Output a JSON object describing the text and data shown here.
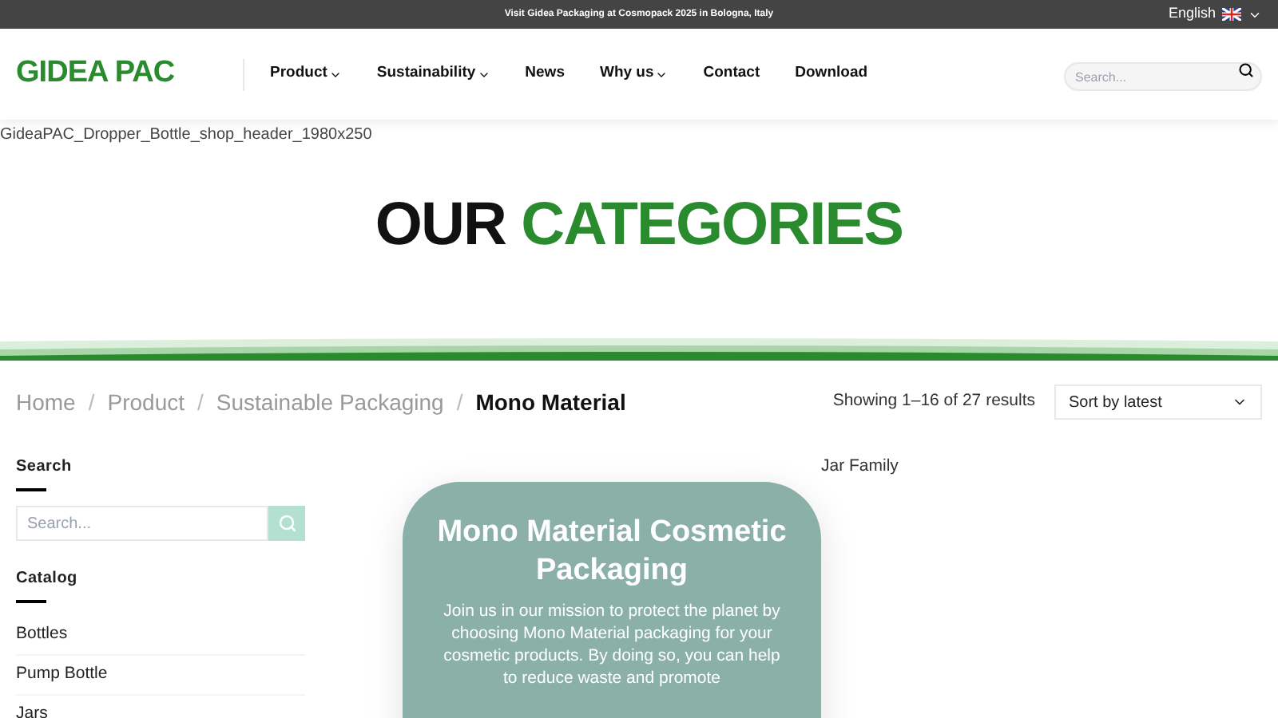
{
  "announcement": "Visit Gidea Packaging at Cosmopack 2025 in Bologna, Italy",
  "language": {
    "label": "English"
  },
  "logo": "GIDEA PAC",
  "nav": [
    {
      "label": "Product",
      "has_menu": true
    },
    {
      "label": "Sustainability",
      "has_menu": true
    },
    {
      "label": "News",
      "has_menu": false
    },
    {
      "label": "Why us",
      "has_menu": true
    },
    {
      "label": "Contact",
      "has_menu": false
    },
    {
      "label": "Download",
      "has_menu": false
    }
  ],
  "header_search": {
    "placeholder": "Search..."
  },
  "banner_alt": "GideaPAC_Dropper_Bottle_shop_header_1980x250",
  "heading": {
    "first": "OUR",
    "second": "CATEGORIES"
  },
  "breadcrumb": [
    {
      "label": "Home",
      "current": false
    },
    {
      "separator": "/"
    },
    {
      "label": "Product",
      "current": false
    },
    {
      "separator": "/"
    },
    {
      "label": "Sustainable Packaging",
      "current": false
    },
    {
      "separator": "/"
    },
    {
      "label": "Mono Material",
      "current": true
    }
  ],
  "result_count": "Showing 1–16 of 27 results",
  "sort": {
    "value": "Sort by latest"
  },
  "sidebar": {
    "search_title": "Search",
    "search_placeholder": "Search...",
    "catalog_title": "Catalog",
    "items": [
      "Bottles",
      "Pump Bottle",
      "Jars"
    ]
  },
  "product_label": "Jar Family",
  "promo": {
    "title": "Mono Material Cosmetic Packaging",
    "text": "Join us in our mission to protect the planet by choosing Mono Material packaging for your cosmetic products. By doing so, you can help to reduce waste and promote"
  }
}
